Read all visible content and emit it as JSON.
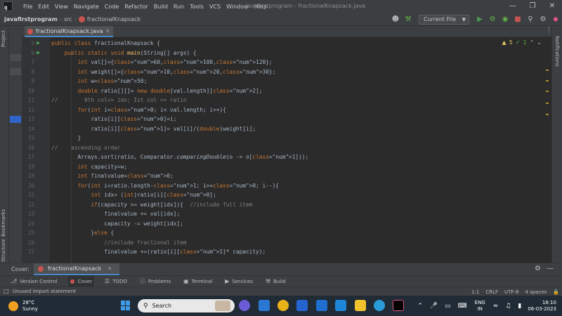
{
  "menu": {
    "items": [
      "File",
      "Edit",
      "View",
      "Navigate",
      "Code",
      "Refactor",
      "Build",
      "Run",
      "Tools",
      "VCS",
      "Window",
      "Help"
    ],
    "window_title": "javafirstprogram - fractionalKnapsack.java"
  },
  "navbar": {
    "project": "javafirstprogram",
    "crumb_src": "src",
    "crumb_file": "fractionalKnapsack",
    "run_config": "Current File"
  },
  "left_stripe": {
    "project_label": "Project",
    "bookmarks_label": "Bookmarks",
    "structure_label": "Structure"
  },
  "right_stripe": {
    "notifications_label": "Notifications"
  },
  "editor": {
    "tab_label": "fractionalKnapsack.java",
    "warnings": "5",
    "weak_warnings": "1",
    "lines": [
      {
        "n": "5",
        "text": "public class fractionalKnapsack {"
      },
      {
        "n": "6",
        "text": "    public static void main(String[] args) {"
      },
      {
        "n": "7",
        "text": "        int val[]={60,100,120};"
      },
      {
        "n": "8",
        "text": "        int weight[]={10,20,30};"
      },
      {
        "n": "9",
        "text": "        int w=50;"
      },
      {
        "n": "10",
        "text": "        double ratio[][]= new double[val.length][2];"
      },
      {
        "n": "11",
        "text": "//        0th col=> idx; Ist col => ratio"
      },
      {
        "n": "12",
        "text": "        for(int i=0; i< val.length; i++){"
      },
      {
        "n": "13",
        "text": "            ratio[i][0]=i;"
      },
      {
        "n": "14",
        "text": "            ratio[i][1]= val[i]/(double)weight[i];"
      },
      {
        "n": "15",
        "text": "        }"
      },
      {
        "n": "16",
        "text": "//    ascending order"
      },
      {
        "n": "17",
        "text": "        Arrays.sort(ratio, Comparator.comparingDouble(o -> o[1]));"
      },
      {
        "n": "18",
        "text": "        int capacity=w;"
      },
      {
        "n": "19",
        "text": "        int finalvalue=0;"
      },
      {
        "n": "20",
        "text": "        for(int i=ratio.length-1; i>=0; i--){"
      },
      {
        "n": "21",
        "text": "            int idx= (int)ratio[i][0];"
      },
      {
        "n": "22",
        "text": "            if(capacity >= weight[idx]){  //include full item"
      },
      {
        "n": "23",
        "text": "                finalvalue += val[idx];"
      },
      {
        "n": "24",
        "text": "                capacity -= weight[idx];"
      },
      {
        "n": "25",
        "text": "            }else {"
      },
      {
        "n": "26",
        "text": "                //include fractional item"
      },
      {
        "n": "27",
        "text": "                finalvalue +=(ratio[i][1]* capacity);"
      }
    ]
  },
  "cover_panel": {
    "label": "Cover:",
    "tab_label": "fractionalKnapsack"
  },
  "tool_windows": [
    "Version Control",
    "Cover",
    "TODO",
    "Problems",
    "Terminal",
    "Services",
    "Build"
  ],
  "status": {
    "message": "Unused import statement",
    "position": "1:1",
    "line_sep": "CRLF",
    "encoding": "UTF-8",
    "indent": "4 spaces"
  },
  "taskbar": {
    "temperature": "28°C",
    "weather": "Sunny",
    "search_label": "Search",
    "lang_top": "ENG",
    "lang_bottom": "IN",
    "time": "18:10",
    "date": "06-03-2023"
  },
  "colors": {
    "keyword": "#cc7832",
    "number": "#6897bb",
    "comment": "#808080",
    "method": "#ffc66d",
    "accent": "#4a88c7"
  }
}
